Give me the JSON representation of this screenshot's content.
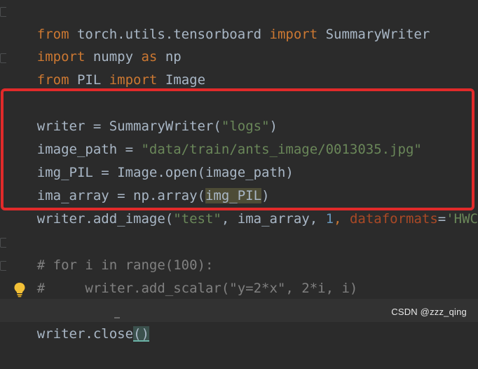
{
  "code": {
    "line1": {
      "kw_from": "from",
      "module": " torch.utils.tensorboard ",
      "kw_import": "import",
      "name": " SummaryWriter"
    },
    "line2": {
      "kw_import": "import",
      "module": " numpy ",
      "kw_as": "as",
      "name": " np"
    },
    "line3": {
      "kw_from": "from",
      "module": " PIL ",
      "kw_import": "import",
      "name": " Image"
    },
    "line4": {
      "lhs": "writer = SummaryWriter(",
      "str": "\"logs\"",
      "rhs": ")"
    },
    "line5": {
      "lhs": "image_path = ",
      "str": "\"data/train/ants_image/0013035.jpg\""
    },
    "line6": {
      "text": "img_PIL = Image.open(image_path)"
    },
    "line7": {
      "lhs": "ima_array = np.array(",
      "hl": "img_PIL",
      "rhs": ")"
    },
    "line8": {
      "a": "writer.add_image(",
      "s1": "\"test\"",
      "b": ", ima_array, ",
      "n1": "1",
      "c": ", ",
      "p1": "dataformats",
      "d": "=",
      "s2": "'HWC'",
      "e": ")"
    },
    "line9": {
      "text": "# for i in range(100):"
    },
    "line10": {
      "text": "#     writer.add_scalar(\"y=2*x\", 2*i, i)"
    },
    "line11": {
      "a": "writer.close",
      "b": "()"
    }
  },
  "watermark": "CSDN @zzz_qing",
  "colors": {
    "background": "#2b2b2b",
    "keyword": "#cc7832",
    "string": "#6a8759",
    "number": "#6897bb",
    "highlight_box": "#e12a2a"
  },
  "icons": [
    "fold-marker-icon",
    "lightbulb-icon"
  ]
}
